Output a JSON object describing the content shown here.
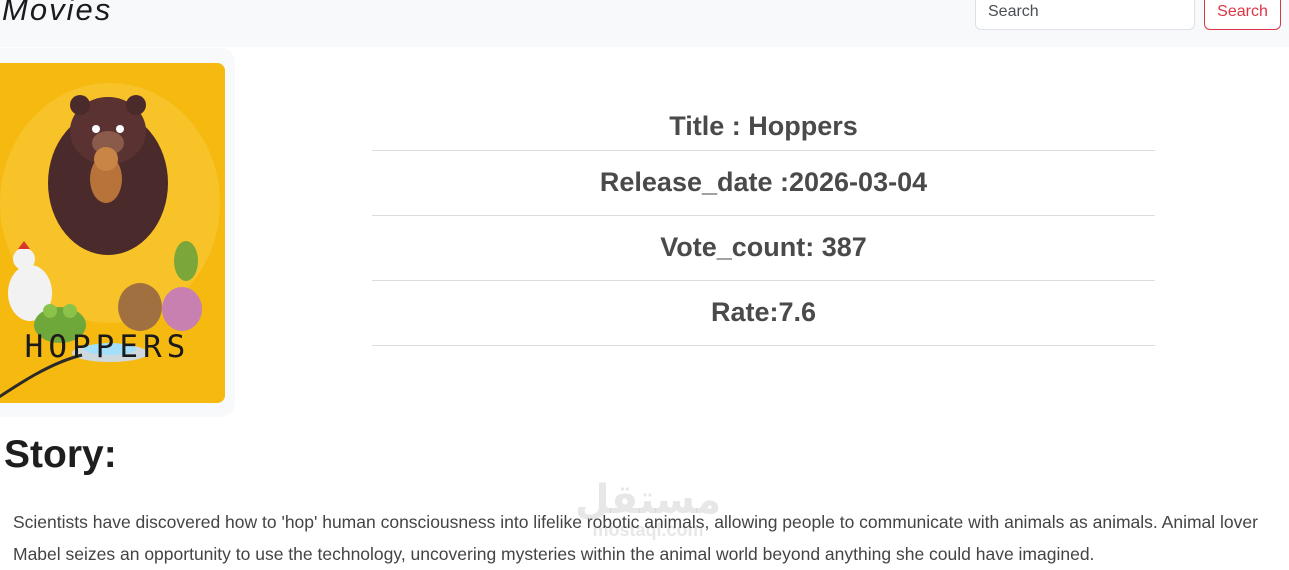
{
  "navbar": {
    "brand": "Movies",
    "search_placeholder": "Search",
    "search_button_label": "Search"
  },
  "poster": {
    "title_text": "HOPPERS",
    "background_color": "#f6b90f"
  },
  "movie": {
    "title_line": "Title : Hoppers",
    "release_line": "Release_date :2026-03-04",
    "vote_line": "Vote_count: 387",
    "rate_line": "Rate:7.6"
  },
  "story": {
    "heading": "Story:",
    "text": "Scientists have discovered how to 'hop' human consciousness into lifelike robotic animals, allowing people to communicate with animals as animals. Animal lover Mabel seizes an opportunity to use the technology, uncovering mysteries within the animal world beyond anything she could have imagined."
  },
  "watermark": {
    "arabic": "مستقل",
    "latin": "mostaql.com"
  }
}
